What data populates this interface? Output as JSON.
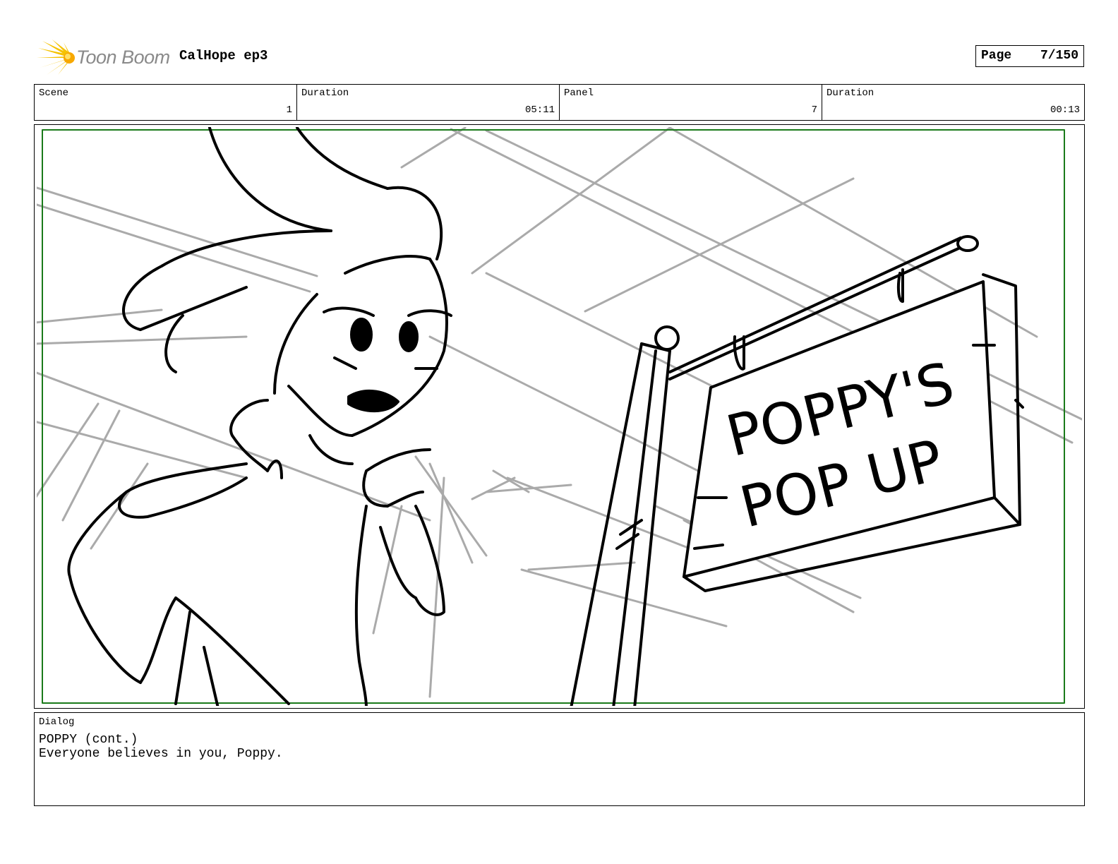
{
  "header": {
    "logo_text": "Toon Boom",
    "project_title": "CalHope ep3",
    "page_label": "Page",
    "page_number": "7/150"
  },
  "info": {
    "scene_label": "Scene",
    "scene_value": "1",
    "scene_duration_label": "Duration",
    "scene_duration_value": "05:11",
    "panel_label": "Panel",
    "panel_value": "7",
    "panel_duration_label": "Duration",
    "panel_duration_value": "00:13"
  },
  "panel": {
    "sign_line1": "POPPY'S",
    "sign_line2": "POP UP"
  },
  "dialog": {
    "label": "Dialog",
    "character": "POPPY (cont.)",
    "line": "Everyone believes in you, Poppy."
  },
  "colors": {
    "safe_frame": "#1a7a1a",
    "sketch_gray": "#aaaaaa",
    "logo_yellow": "#f5c200"
  }
}
